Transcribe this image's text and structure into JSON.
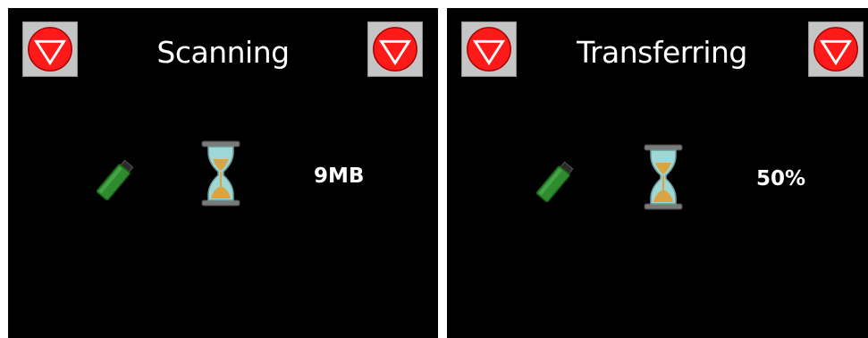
{
  "panels": [
    {
      "title": "Scanning",
      "left_button": {
        "icon": "stop-icon",
        "color": "#ff1a1a"
      },
      "right_button": {
        "icon": "stop-icon",
        "color": "#ff1a1a"
      },
      "device_icon": "usb-drive-icon",
      "status_icon": "hourglass-icon",
      "value": "9MB"
    },
    {
      "title": "Transferring",
      "left_button": {
        "icon": "stop-icon",
        "color": "#ff1a1a"
      },
      "right_button": {
        "icon": "stop-icon",
        "color": "#ff1a1a"
      },
      "device_icon": "usb-drive-icon",
      "status_icon": "hourglass-icon",
      "value": "50%"
    }
  ],
  "colors": {
    "panel_background": "#000000",
    "text": "#ffffff",
    "button_face": "#c5c5c5",
    "stop_red": "#ff1a1a",
    "usb_green": "#2e8b2e",
    "hourglass_sand": "#d9a441",
    "hourglass_glass": "#9fd7d7"
  }
}
